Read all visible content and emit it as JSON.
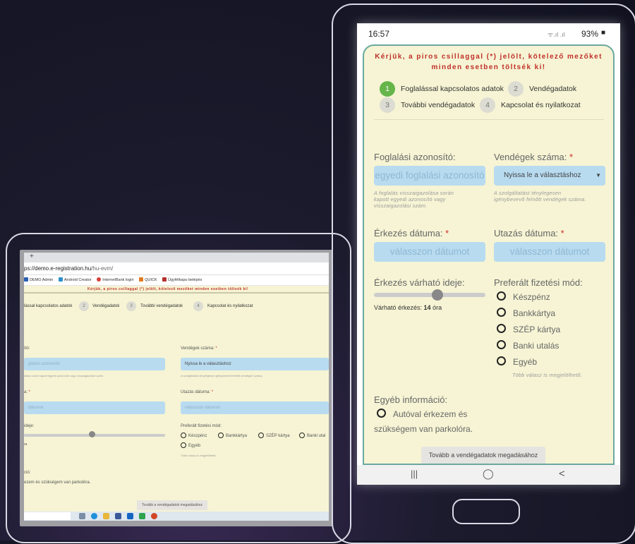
{
  "tablet": {
    "tab_plus": "+",
    "url_prefix": "ps://demo.e-registration.hu",
    "url_path": "/hu-evm/",
    "bookmarks": [
      {
        "label": "DEMO Admin",
        "color": "#2b5fb4"
      },
      {
        "label": "Android Creator",
        "color": "#2f8ec9"
      },
      {
        "label": "InternetBank login",
        "color": "#d43f3a"
      },
      {
        "label": "QUICK",
        "color": "#e07b22"
      },
      {
        "label": "Ügyfélkapu belépés",
        "color": "#b3312e"
      }
    ],
    "warning": "Kérjük, a piros csillaggal (*) jelölt, kötelező mezőket minden esetben töltsék ki!",
    "steps": {
      "s1": "lással kapcsolatos adatok",
      "n2": "2",
      "s2": "Vendégadatok",
      "n3": "3",
      "s3": "További vendégadatok",
      "n4": "4",
      "s4": "Kapcsolat és nyilatkozat"
    },
    "booking_label": "ító:",
    "booking_placeholder": "glalási azonosító",
    "booking_hint": "dlása során kapott egyedi azonosító vagy visszaigazolási szám.",
    "guests_label": "Vendégek száma:",
    "guests_req": " *",
    "guests_select": "Nyissa le a választáshoz",
    "guests_hint": "A szolgáltatást ténylegesen igénybevevő felnőtt vendégek száma.",
    "arrival_label": "a:",
    "arrival_req": " *",
    "arrival_placeholder": "dátumot",
    "departure_label": "Utazás dátuma:",
    "departure_req": " *",
    "departure_placeholder": "válasszon dátumot",
    "time_label": "ideje:",
    "time_value": "ra",
    "payment_label": "Preferált fizetési mód:",
    "payments": [
      "Készpénz",
      "Bankkártya",
      "SZÉP kártya",
      "Banki utal",
      "Egyéb"
    ],
    "payment_hint": "Több válasz is megjelölhető.",
    "other_label": "ció:",
    "other_text": "ezem és szükségem van parkolóra.",
    "next_button": "Tovább a vendégadatok megadásához"
  },
  "phone": {
    "time": "16:57",
    "signal": "ᯤ.ıl .ıl",
    "battery": "93%",
    "battery_icon": "■",
    "warning": "Kérjük, a piros csillaggal (*) jelölt, kötelező mezőket minden esetben töltsék ki!",
    "steps": [
      {
        "num": "1",
        "label": "Foglalással kapcsolatos adatok",
        "active": true
      },
      {
        "num": "2",
        "label": "Vendégadatok",
        "active": false
      },
      {
        "num": "3",
        "label": "További vendégadatok",
        "active": false
      },
      {
        "num": "4",
        "label": "Kapcsolat és nyilatkozat",
        "active": false
      }
    ],
    "booking_label": "Foglalási azonosító:",
    "booking_placeholder": "egyedi foglalási azonosító",
    "booking_hint": [
      "A foglalás visszaigazolása során",
      "kapott egyedi azonosító vagy",
      "visszaigazolási szám."
    ],
    "guests_label": "Vendégek száma:",
    "guests_req": " *",
    "guests_select": "Nyissa le a választáshoz",
    "guests_hint": [
      "A szolgáltatást ténylegesen",
      "igénybevevő felnőtt vendégek száma."
    ],
    "arrival_label": "Érkezés dátuma:",
    "arrival_req": " *",
    "arrival_placeholder": "válasszon dátumot",
    "departure_label": "Utazás dátuma:",
    "departure_req": " *",
    "departure_placeholder": "válasszon dátumot",
    "time_label": "Érkezés várható ideje:",
    "arrival_time_prefix": "Várható érkezés: ",
    "arrival_time_value": "14",
    "arrival_time_unit": " óra",
    "payment_label": "Preferált fizetési mód:",
    "payments": [
      "Készpénz",
      "Bankkártya",
      "SZÉP kártya",
      "Banki utalás",
      "Egyéb"
    ],
    "payment_hint": "Több válasz is megjelölhető.",
    "other_label": "Egyéb információ:",
    "other_option_line1": "Autóval érkezem és",
    "other_option_line2": "szükségem van parkolóra.",
    "next_button": "Tovább a vendégadatok megadásához",
    "nav_recent": "|||",
    "nav_home": "◯",
    "nav_back": "<"
  },
  "colors": {
    "page_bg": "#f6f4d4",
    "input_bg": "#b8dbf0",
    "warning_red": "#c0302a",
    "active_step": "#66b54a",
    "frame_border": "#d9d9e6"
  }
}
